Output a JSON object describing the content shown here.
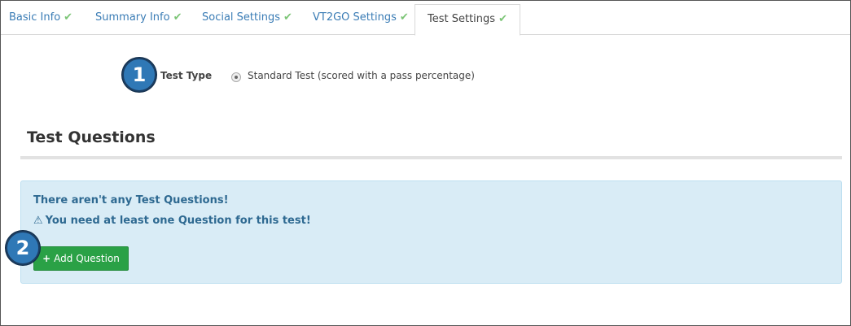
{
  "tabs": [
    {
      "label": "Basic Info",
      "check": "✔"
    },
    {
      "label": "Summary Info",
      "check": "✔"
    },
    {
      "label": "Social Settings",
      "check": "✔"
    },
    {
      "label": "VT2GO Settings",
      "check": "✔"
    },
    {
      "label": "Test Settings",
      "check": "✔"
    }
  ],
  "callouts": {
    "one": "1",
    "two": "2"
  },
  "test_type": {
    "label": "Test Type",
    "option_label": "Standard Test (scored with a pass percentage)"
  },
  "section": {
    "title": "Test Questions"
  },
  "alert": {
    "line1": "There aren't any Test Questions!",
    "line2": "You need at least one Question for this test!",
    "warning_icon": "⚠"
  },
  "add_button": {
    "label": "Add Question",
    "icon": "+"
  },
  "colors": {
    "tab_link": "#3a7cb5",
    "check": "#7cc576",
    "alert_bg": "#d9ecf6",
    "alert_text": "#2e6991",
    "button_green": "#2aa146",
    "callout_blue": "#2f78b6"
  }
}
